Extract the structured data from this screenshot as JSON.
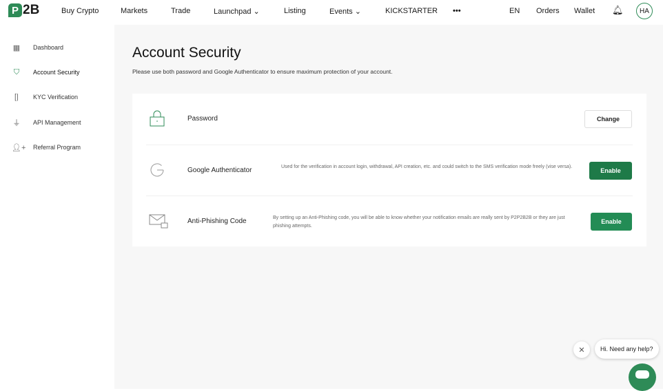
{
  "header": {
    "logo": "P2B",
    "nav": [
      "Buy Crypto",
      "Markets",
      "Trade",
      "Launchpad",
      "Listing",
      "Events",
      "KICKSTARTER",
      "•••"
    ],
    "lang": "EN",
    "orders": "Orders",
    "wallet": "Wallet",
    "avatar": "HA"
  },
  "sidebar": {
    "items": [
      {
        "label": "Dashboard",
        "icon": "grid-icon"
      },
      {
        "label": "Account Security",
        "icon": "shield-icon"
      },
      {
        "label": "KYC Verification",
        "icon": "id-card-icon"
      },
      {
        "label": "API Management",
        "icon": "plug-icon"
      },
      {
        "label": "Referral Program",
        "icon": "user-plus-icon"
      }
    ]
  },
  "main": {
    "title": "Account Security",
    "subtitle": "Please use both password and Google Authenticator to ensure maximum protection of your account.",
    "rows": [
      {
        "title": "Password",
        "button": "Change"
      },
      {
        "title": "Google Authenticator",
        "desc": "Used for the verification in account login, withdrawal, API creation, etc. and could switch to the SMS verification mode freely (vise versa).",
        "button": "Enable"
      },
      {
        "title": "Anti-Phishing Code",
        "desc": "By setting up an Anti-Phishing code, you will be able to know whether your notification emails are really sent by P2P2B2B or they are just phishing attempts.",
        "button": "Enable"
      }
    ]
  },
  "chat": {
    "message": "Hi. Need any help?"
  },
  "colors": {
    "accent": "#2e8b57"
  }
}
